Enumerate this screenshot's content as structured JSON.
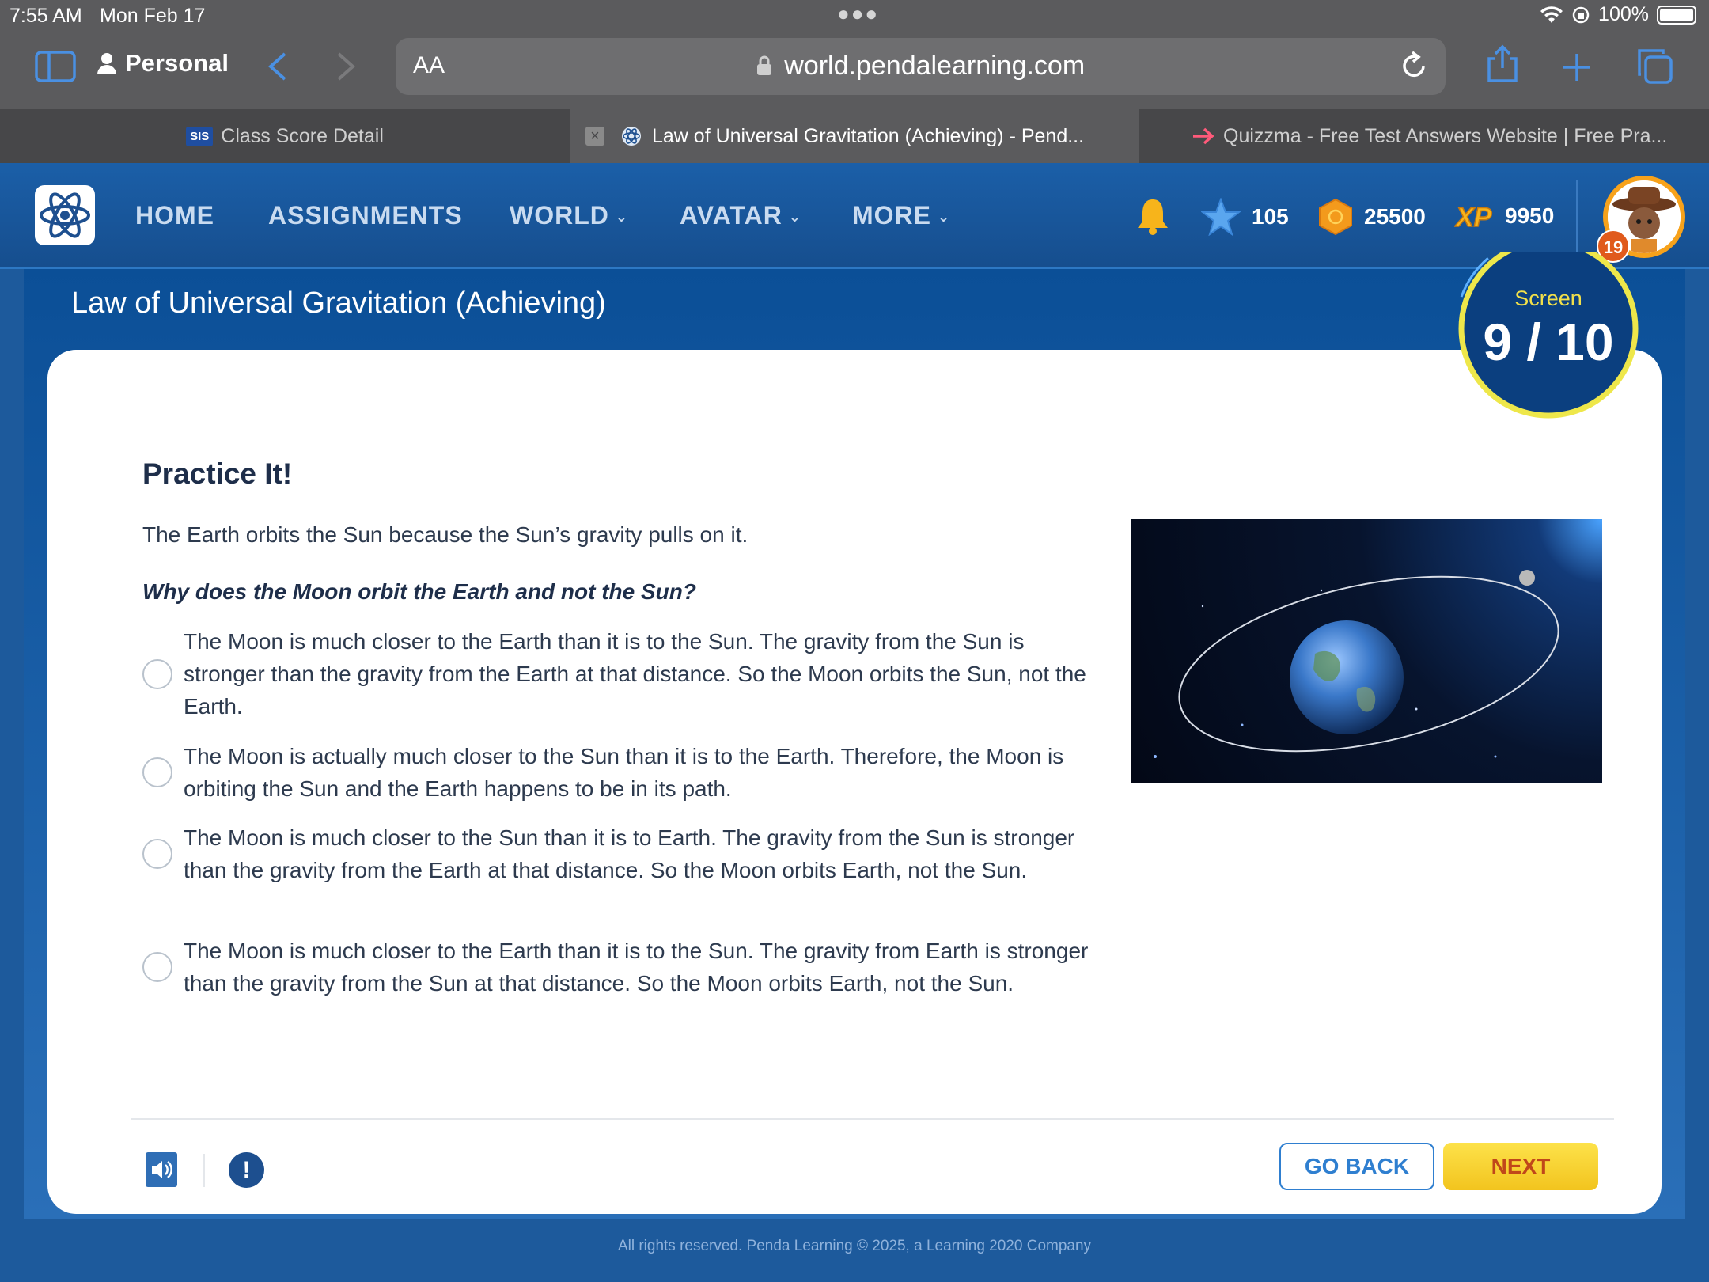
{
  "status_bar": {
    "time": "7:55 AM",
    "date": "Mon Feb 17",
    "battery": "100%"
  },
  "browser": {
    "profile": "Personal",
    "text_size_label": "AA",
    "url": "world.pendalearning.com",
    "tabs": [
      {
        "label": "Class Score Detail",
        "badge": "SIS"
      },
      {
        "label": "Law of Universal Gravitation (Achieving) - Pend..."
      },
      {
        "label": "Quizzma - Free Test Answers Website | Free Pra..."
      }
    ]
  },
  "nav": {
    "links": [
      "HOME",
      "ASSIGNMENTS",
      "WORLD",
      "AVATAR",
      "MORE"
    ],
    "stars": "105",
    "gems": "25500",
    "xp": "9950",
    "level": "19"
  },
  "lesson": {
    "title": "Law of Universal Gravitation (Achieving)",
    "screen_label": "Screen",
    "screen_progress": "9 / 10"
  },
  "question": {
    "heading": "Practice It!",
    "intro": "The Earth orbits the Sun because the Sun’s gravity pulls on it.",
    "prompt": "Why does the Moon orbit the Earth and not the Sun?",
    "options": [
      "The Moon is much closer to the Earth than it is to the Sun. The gravity from the Sun is stronger than the gravity from the Earth at that distance. So the Moon orbits the Sun, not the Earth.",
      "The Moon is actually much closer to the Sun than it is to the Earth. Therefore, the Moon is orbiting the Sun and the Earth happens to be in its path.",
      "The Moon is much closer to the Sun than it is to Earth. The gravity from the Sun is stronger than the gravity from the Earth at that distance. So the Moon orbits Earth, not the Sun.",
      "The Moon is much closer to the Earth than it is to the Sun. The gravity from Earth is stronger than the gravity from the Sun at that distance. So the Moon orbits Earth, not the Sun."
    ]
  },
  "footer": {
    "info_icon": "!",
    "go_back": "GO BACK",
    "next": "NEXT",
    "copyright": "All rights reserved. Penda Learning © 2025, a Learning 2020 Company"
  }
}
